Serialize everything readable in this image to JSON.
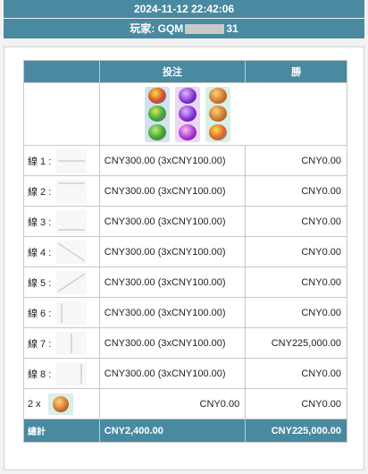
{
  "header": {
    "datetime": "2024-11-12 22:42:06",
    "player_label": "玩家: GQM",
    "player_suffix": "31"
  },
  "table": {
    "col_bet": "投注",
    "col_win": "勝",
    "reels": [
      [
        "symbol-ball-multicolor",
        "symbol-ball-purple",
        "symbol-ball-orange"
      ],
      [
        "symbol-ball-multicolor",
        "symbol-ball-purple",
        "symbol-ball-orange"
      ],
      [
        "symbol-ball-green",
        "symbol-ball-purple",
        "symbol-ball-multicolor"
      ]
    ],
    "lines": [
      {
        "label": "線 1 :",
        "bet": "CNY300.00 (3xCNY100.00)",
        "win": "CNY0.00"
      },
      {
        "label": "線 2 :",
        "bet": "CNY300.00 (3xCNY100.00)",
        "win": "CNY0.00"
      },
      {
        "label": "線 3 :",
        "bet": "CNY300.00 (3xCNY100.00)",
        "win": "CNY0.00"
      },
      {
        "label": "線 4 :",
        "bet": "CNY300.00 (3xCNY100.00)",
        "win": "CNY0.00"
      },
      {
        "label": "線 5 :",
        "bet": "CNY300.00 (3xCNY100.00)",
        "win": "CNY0.00"
      },
      {
        "label": "線 6 :",
        "bet": "CNY300.00 (3xCNY100.00)",
        "win": "CNY0.00"
      },
      {
        "label": "線 7 :",
        "bet": "CNY300.00 (3xCNY100.00)",
        "win": "CNY225,000.00"
      },
      {
        "label": "線 8 :",
        "bet": "CNY300.00 (3xCNY100.00)",
        "win": "CNY0.00"
      }
    ],
    "scatter": {
      "label": "2 x",
      "icon": "symbol-scatter-icon",
      "bet": "CNY0.00",
      "win": "CNY0.00"
    },
    "total": {
      "label": "總計",
      "bet": "CNY2,400.00",
      "win": "CNY225,000.00"
    }
  },
  "colors": {
    "accent": "#4a8aa0"
  }
}
